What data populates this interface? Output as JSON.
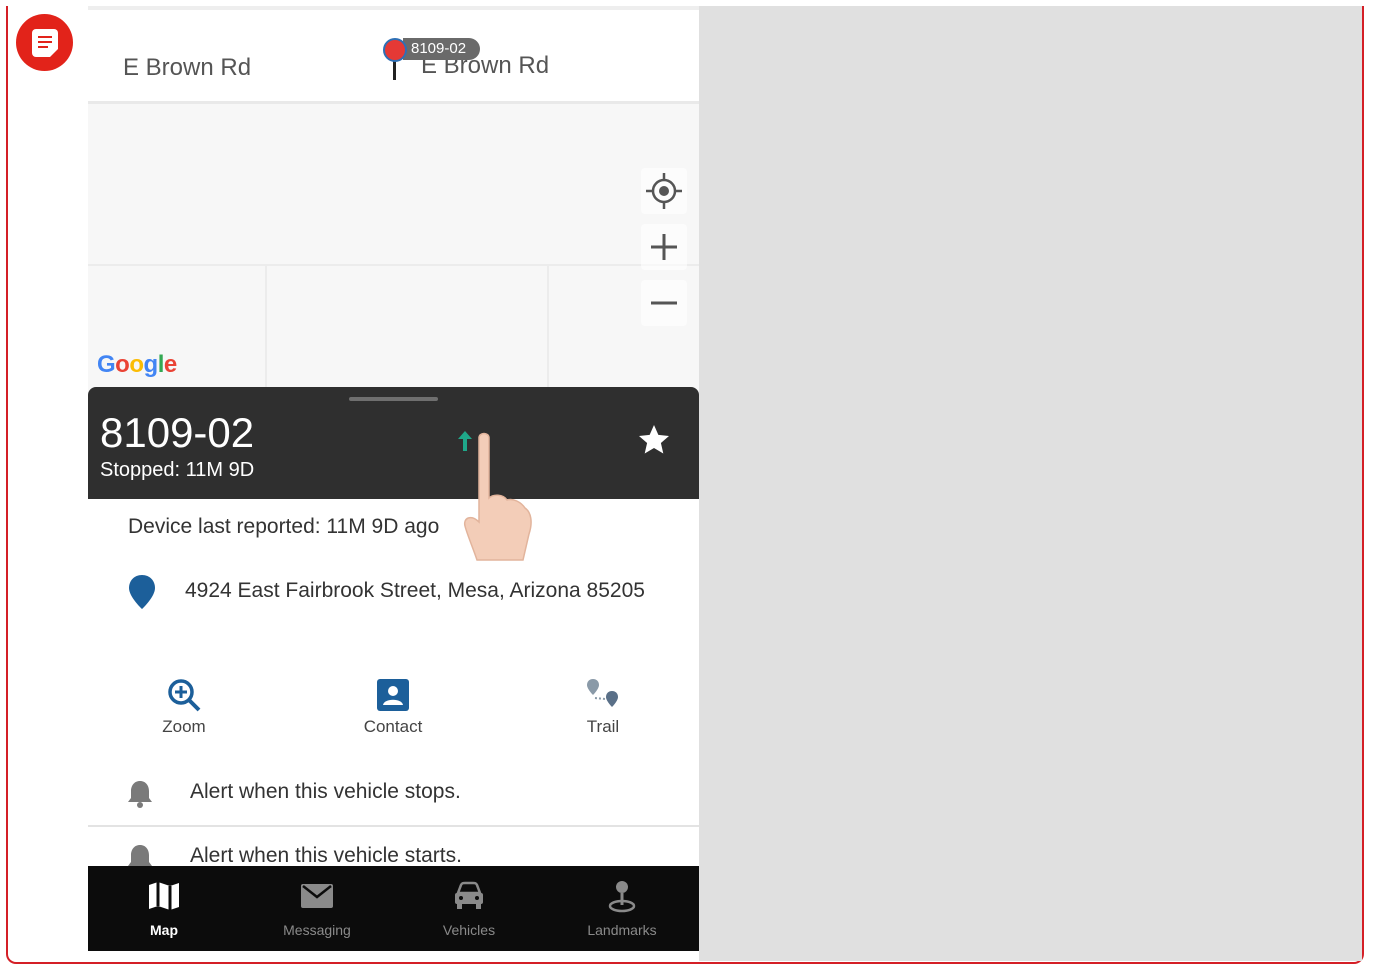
{
  "colors": {
    "accent_red": "#e2231a",
    "sheet_dark": "#2f2f2f",
    "link_blue": "#1c5f9a",
    "direction_green": "#1fa88a",
    "tabbar_bg": "#0c0c0c"
  },
  "map": {
    "road_left": "E Brown Rd",
    "road_right": "E Brown Rd",
    "marker_label": "8109-02",
    "google_logo": "Google",
    "controls": [
      "my-location-icon",
      "zoom-in-icon",
      "zoom-out-icon"
    ]
  },
  "vehicle": {
    "name": "8109-02",
    "status": "Stopped: 11M  9D",
    "last_reported": "Device last reported: 11M  9D ago",
    "address": "4924 East Fairbrook Street, Mesa, Arizona 85205"
  },
  "actions": [
    {
      "label": "Zoom",
      "icon": "zoom-in-magnifier-icon"
    },
    {
      "label": "Contact",
      "icon": "contact-card-icon"
    },
    {
      "label": "Trail",
      "icon": "trail-icon"
    }
  ],
  "alerts": [
    {
      "label": "Alert when this vehicle stops.",
      "icon": "bell-icon"
    },
    {
      "label": "Alert when this vehicle starts.",
      "icon": "bell-icon"
    }
  ],
  "tabs": [
    {
      "label": "Map",
      "icon": "map-icon",
      "active": true
    },
    {
      "label": "Messaging",
      "icon": "envelope-icon",
      "active": false
    },
    {
      "label": "Vehicles",
      "icon": "car-icon",
      "active": false
    },
    {
      "label": "Landmarks",
      "icon": "landmark-pin-icon",
      "active": false
    }
  ]
}
